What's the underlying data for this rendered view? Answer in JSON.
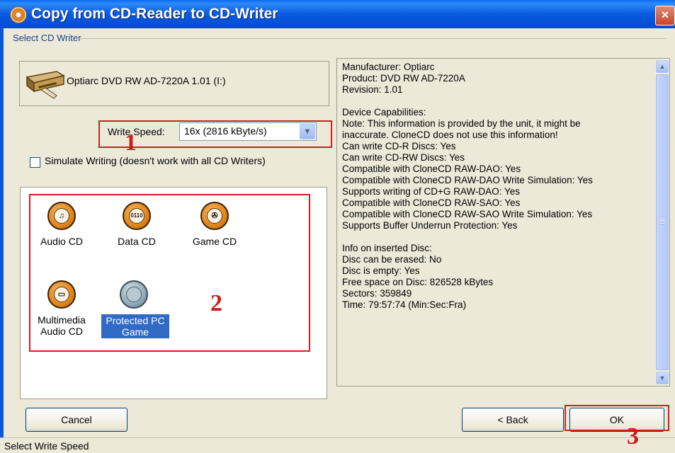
{
  "window": {
    "title": "Copy from CD-Reader to CD-Writer",
    "close_label": "×",
    "group_label": "Select CD Writer"
  },
  "drive": {
    "name": "Optiarc DVD RW AD-7220A 1.01 (I:)",
    "icon": "cd-drive-icon"
  },
  "write_speed": {
    "label": "Write Speed:",
    "value": "16x (2816 kByte/s)"
  },
  "simulate": {
    "label": "Simulate Writing (doesn't work with all CD Writers)",
    "checked": false
  },
  "disc_types": [
    {
      "label": "Audio CD",
      "icon": "audio-cd-icon",
      "glyph": "♫",
      "selected": false
    },
    {
      "label": "Data CD",
      "icon": "data-cd-icon",
      "glyph": "0110",
      "selected": false
    },
    {
      "label": "Game CD",
      "icon": "game-cd-icon",
      "glyph": "✇",
      "selected": false
    },
    {
      "label": "Multimedia Audio CD",
      "icon": "multimedia-audio-cd-icon",
      "glyph": "▭",
      "selected": false
    },
    {
      "label": "Protected PC Game",
      "icon": "protected-pc-game-icon",
      "glyph": "",
      "selected": true
    }
  ],
  "info_lines": [
    "Manufacturer: Optiarc",
    "Product: DVD RW AD-7220A",
    "Revision: 1.01",
    "",
    "Device Capabilities:",
    "Note: This information is provided by the unit, it might be",
    "inaccurate. CloneCD does not use this information!",
    "Can write CD-R Discs: Yes",
    "Can write CD-RW Discs: Yes",
    "Compatible with CloneCD RAW-DAO: Yes",
    "Compatible with CloneCD RAW-DAO Write Simulation: Yes",
    "Supports writing of CD+G RAW-DAO: Yes",
    "Compatible with CloneCD RAW-SAO: Yes",
    "Compatible with CloneCD RAW-SAO Write Simulation: Yes",
    "Supports Buffer Underrun Protection: Yes",
    "",
    "Info on inserted Disc:",
    "Disc can be erased: No",
    "Disc is empty: Yes",
    "Free space on Disc: 826528 kBytes",
    "Sectors: 359849",
    "Time: 79:57:74 (Min:Sec:Fra)"
  ],
  "buttons": {
    "cancel": "Cancel",
    "back": "< Back",
    "ok": "OK"
  },
  "status": "Select Write Speed",
  "annotations": {
    "n1": "1",
    "n2": "2",
    "n3": "3",
    "color": "#c81e1e"
  }
}
